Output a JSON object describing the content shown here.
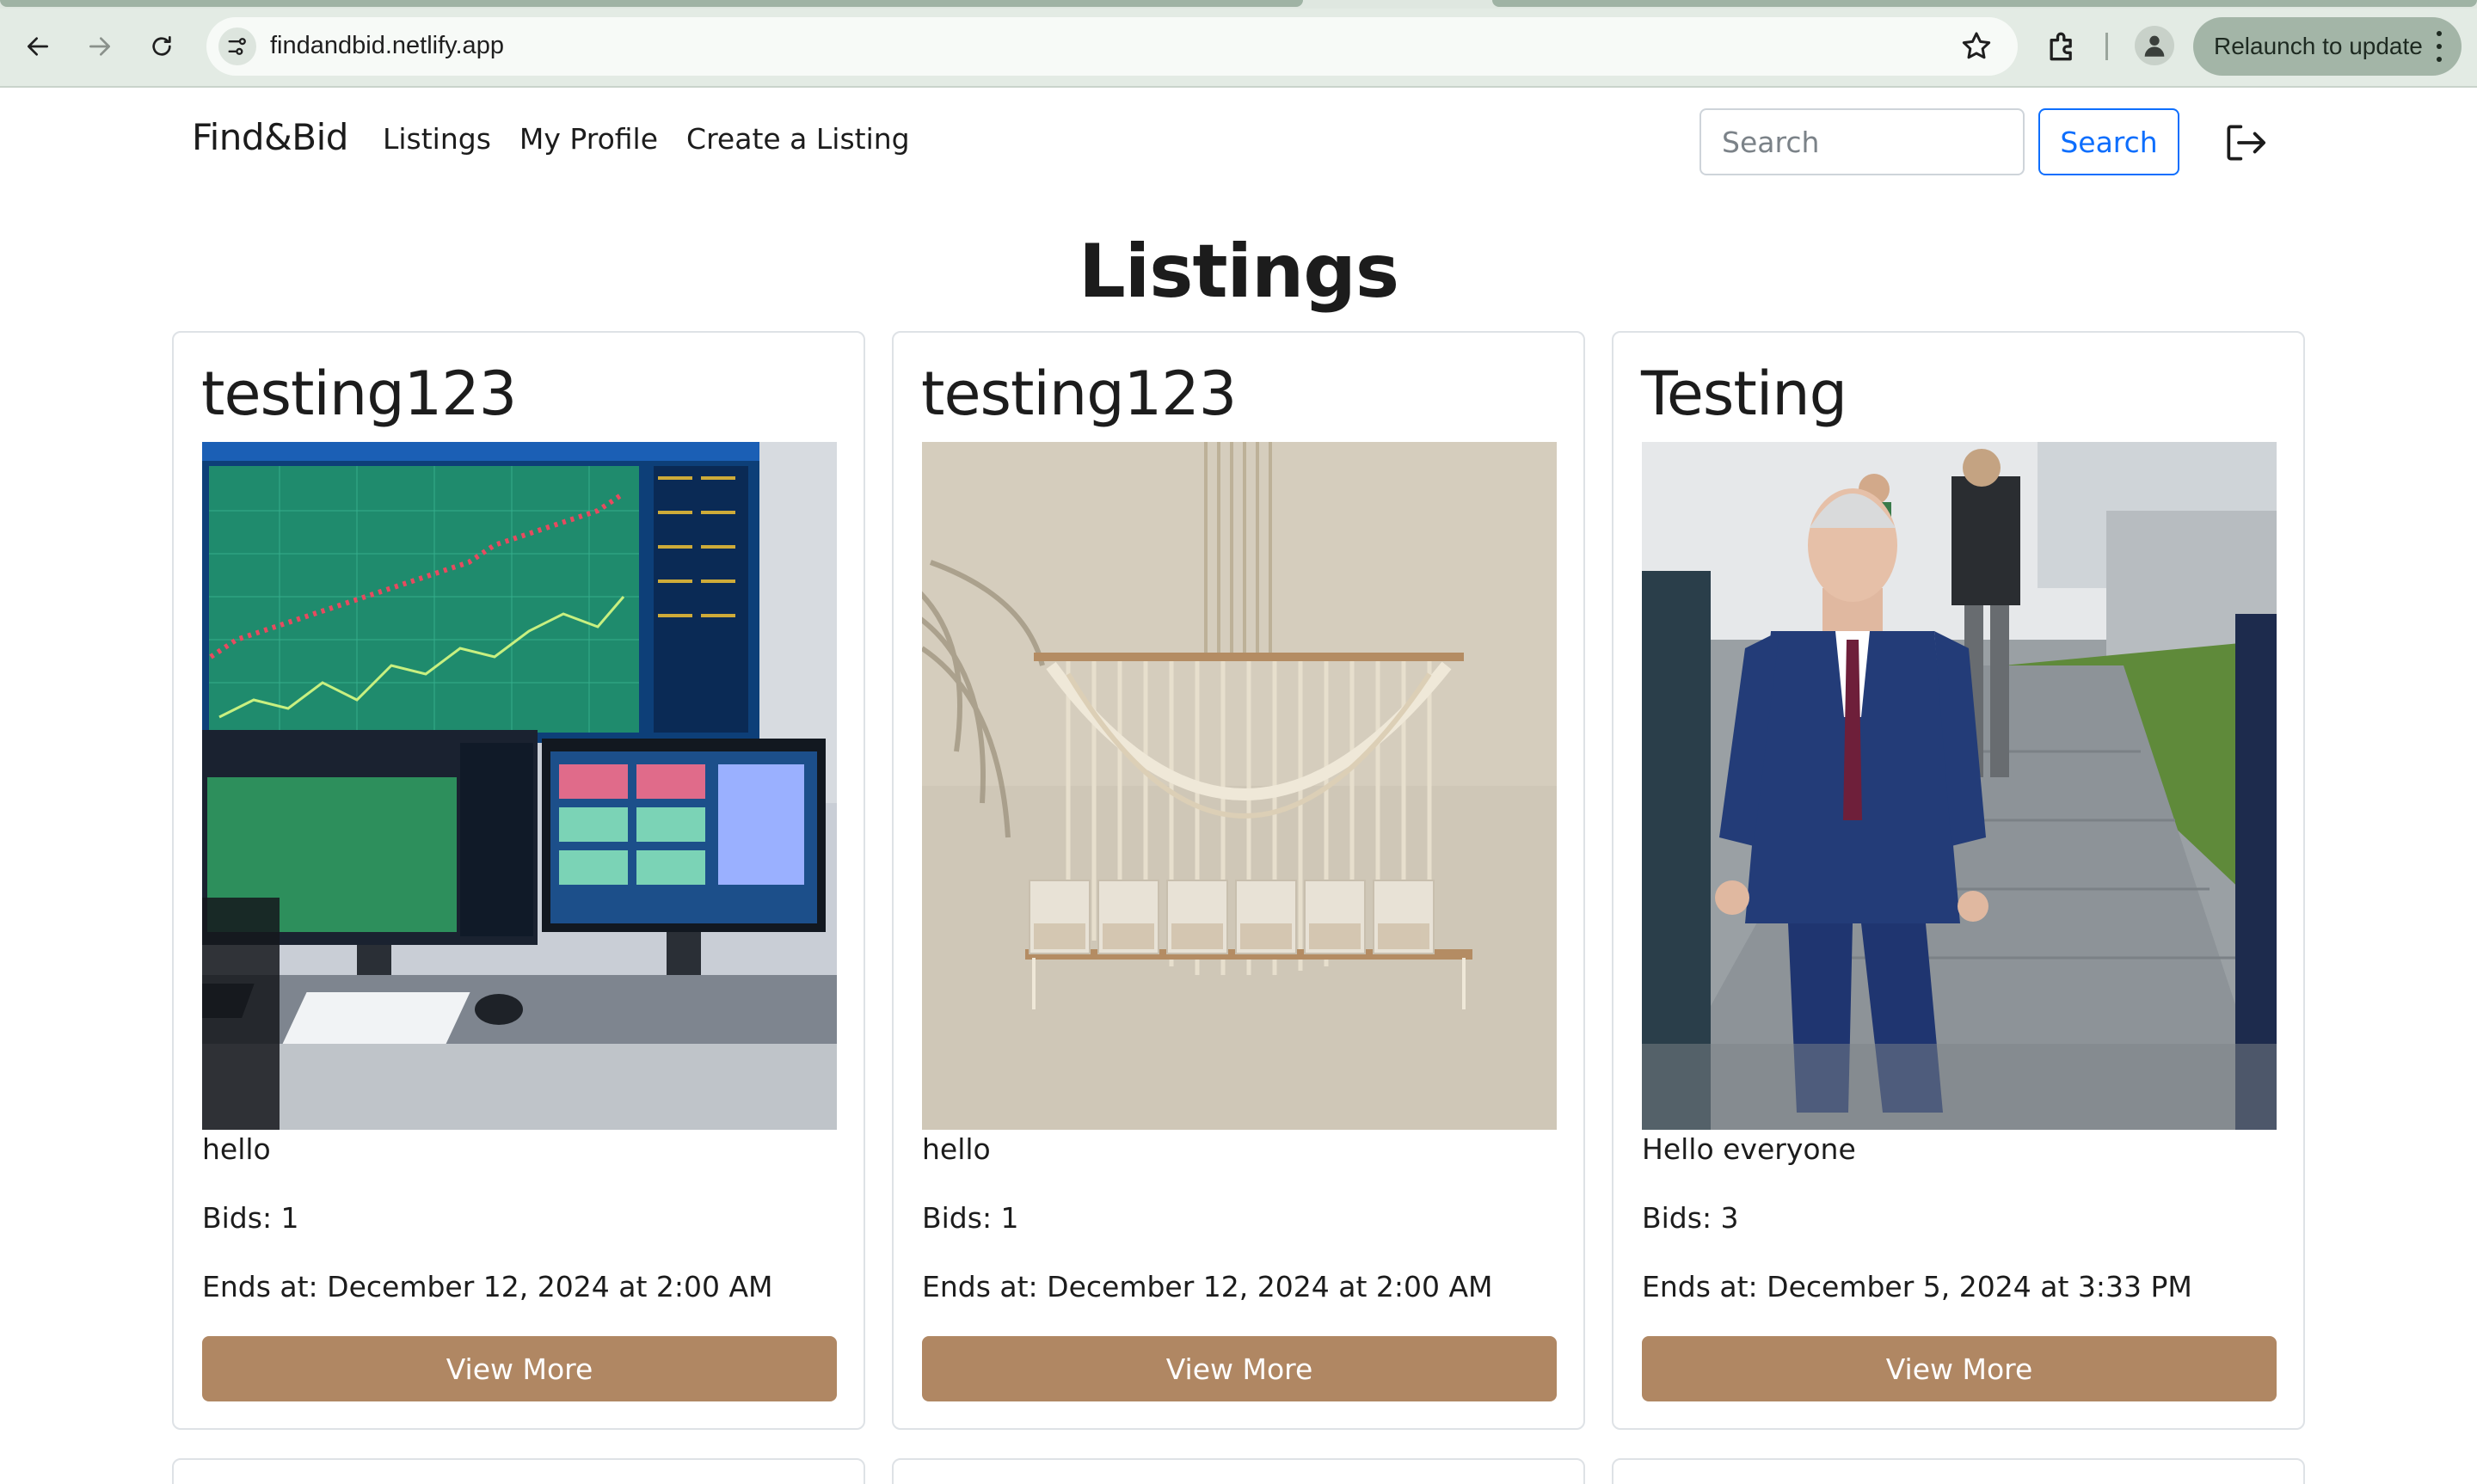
{
  "browser": {
    "url": "findandbid.netlify.app",
    "relaunch_label": "Relaunch to update"
  },
  "nav": {
    "brand": "Find&Bid",
    "links": [
      "Listings",
      "My Profile",
      "Create a Listing"
    ],
    "search_placeholder": "Search",
    "search_button": "Search"
  },
  "page": {
    "title": "Listings"
  },
  "listings": [
    {
      "title": "testing123",
      "description": "hello",
      "bids": "Bids: 1",
      "ends": "Ends at: December 12, 2024 at 2:00 AM",
      "button": "View More",
      "image": "trading-monitors-photo"
    },
    {
      "title": "testing123",
      "description": "hello",
      "bids": "Bids: 1",
      "ends": "Ends at: December 12, 2024 at 2:00 AM",
      "button": "View More",
      "image": "macrame-wall-hanging-photo"
    },
    {
      "title": "Testing",
      "description": "Hello everyone",
      "bids": "Bids: 3",
      "ends": "Ends at: December 5, 2024 at 3:33 PM",
      "button": "View More",
      "image": "man-in-suit-photo"
    }
  ],
  "colors": {
    "accent_button": "#b08763",
    "search_outline": "#0d6efd",
    "chrome_bg": "#e3ebe4"
  }
}
